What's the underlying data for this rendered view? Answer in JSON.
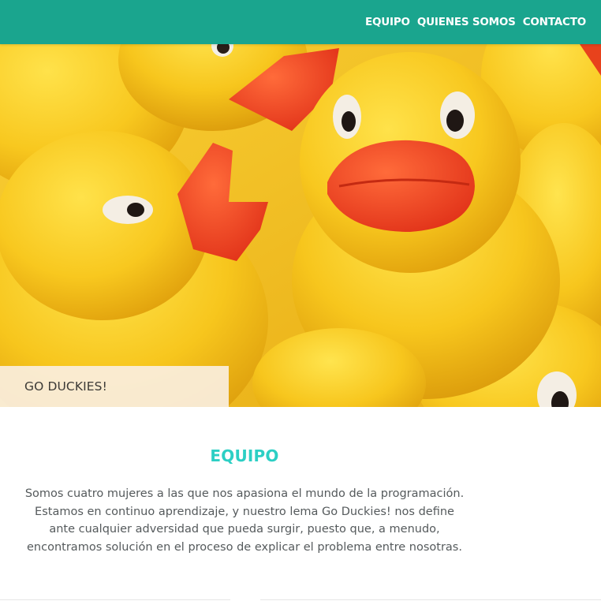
{
  "nav": {
    "items": [
      {
        "label": "EQUIPO"
      },
      {
        "label": "QUIENES SOMOS"
      },
      {
        "label": "CONTACTO"
      }
    ]
  },
  "hero": {
    "caption": "GO DUCKIES!"
  },
  "section": {
    "title": "EQUIPO",
    "text": "Somos cuatro mujeres a las que nos apasiona el mundo de la programación. Estamos en continuo aprendizaje, y nuestro lema Go Duckies! nos define ante cualquier adversidad que pueda surgir, puesto que, a menudo, encontramos solución en el proceso de explicar el problema entre nosotras."
  },
  "colors": {
    "navbar": "#1aa58e",
    "title": "#2ccfc4",
    "text": "#555a5c",
    "duck_yellow": "#f6c21c",
    "beak_orange": "#ee4a1e"
  }
}
